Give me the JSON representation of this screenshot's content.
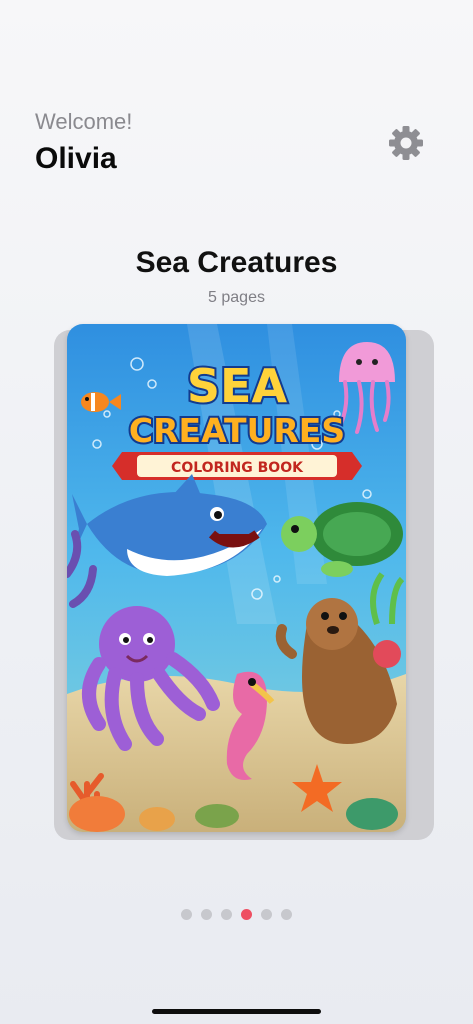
{
  "header": {
    "greeting": "Welcome!",
    "user_name": "Olivia",
    "settings_icon": "gear-icon"
  },
  "book": {
    "title": "Sea Creatures",
    "pages_label": "5 pages",
    "cover": {
      "title_line1": "SEA",
      "title_line2": "CREATURES",
      "banner": "COLORING BOOK"
    }
  },
  "pager": {
    "count": 6,
    "active_index": 3,
    "active_color": "#ee4f62",
    "inactive_color": "#c7c8cd"
  }
}
